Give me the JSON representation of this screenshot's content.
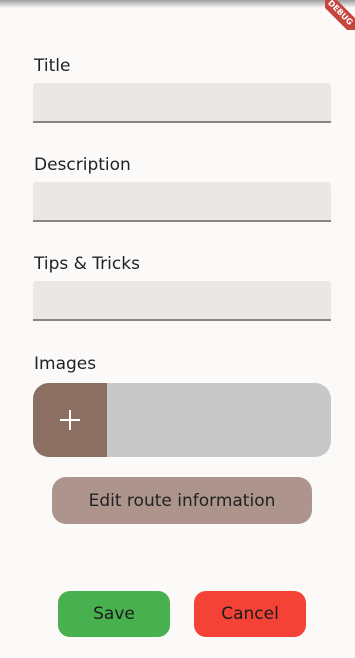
{
  "debug_banner": "DEBUG",
  "form": {
    "title_label": "Title",
    "description_label": "Description",
    "tips_label": "Tips & Tricks",
    "images_label": "Images",
    "title_value": "",
    "description_value": "",
    "tips_value": ""
  },
  "buttons": {
    "edit_route": "Edit route information",
    "save": "Save",
    "cancel": "Cancel"
  },
  "colors": {
    "save": "#48b04e",
    "cancel": "#f44336",
    "add_image": "#8b6f63",
    "edit_route": "#ad958e"
  }
}
